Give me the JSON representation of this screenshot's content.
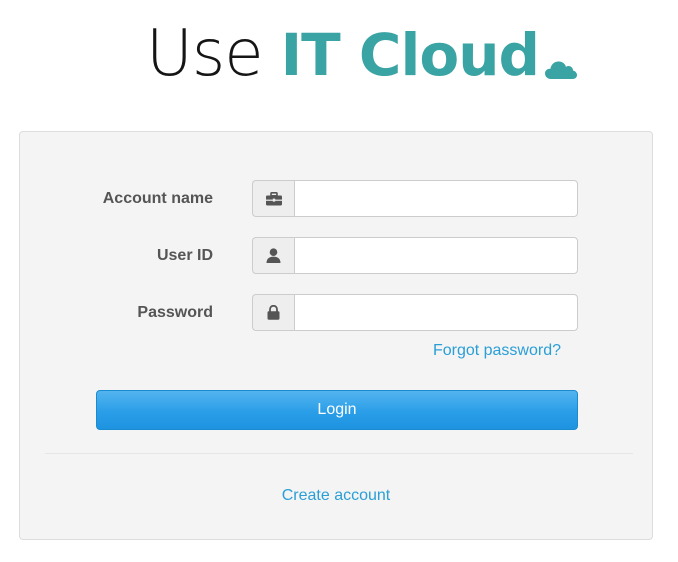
{
  "logo": {
    "light_text": "Use",
    "bold_text": "IT Cloud",
    "icon": "cloud-icon",
    "accent_color": "#3aa3a3"
  },
  "form": {
    "account_name": {
      "label": "Account name",
      "icon": "briefcase-icon",
      "value": "",
      "placeholder": ""
    },
    "user_id": {
      "label": "User ID",
      "icon": "user-icon",
      "value": "",
      "placeholder": ""
    },
    "password": {
      "label": "Password",
      "icon": "lock-icon",
      "value": "",
      "placeholder": ""
    },
    "forgot_password_label": "Forgot password?",
    "login_label": "Login",
    "create_account_label": "Create account"
  },
  "colors": {
    "link": "#2a9fd6",
    "button": "#2a9ee8",
    "panel_background": "#f4f4f4"
  }
}
